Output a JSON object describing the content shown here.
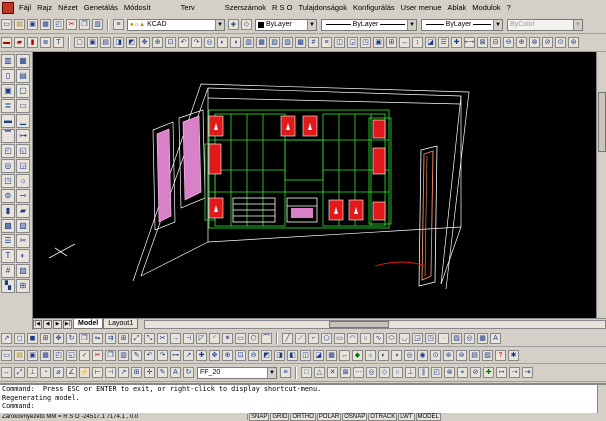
{
  "menubar": {
    "items": [
      "Fájl",
      "Rajz",
      "Nézet",
      "Genetálás",
      "Módosít",
      "Terv",
      "Szerszámok",
      "R S O",
      "Tulajdonságok",
      "Konfigurálás",
      "User menue",
      "Ablak",
      "Modulok",
      "?"
    ]
  },
  "properties": {
    "layer": "KCAD",
    "color": "ByLayer",
    "linetype": "ByLayer",
    "lineweight": "ByLayer",
    "plotstyle": "ByColor"
  },
  "style_combo": "FF_20",
  "tabs": {
    "model": "Model",
    "layout1": "Layout1"
  },
  "command": {
    "lines": [
      "Command:  Press ESC or ENTER to exit, or right-click to display shortcut-menu.",
      "Regenerating model.",
      "Command:"
    ]
  },
  "status": {
    "coords": "Zárókovnyezetű MM = R S O  -24517.1  7174.1 , 0.0",
    "buttons": [
      "SNAP",
      "GRID",
      "ORTHO",
      "POLAR",
      "OSNAP",
      "OTRACK",
      "LWT",
      "MODEL"
    ]
  }
}
